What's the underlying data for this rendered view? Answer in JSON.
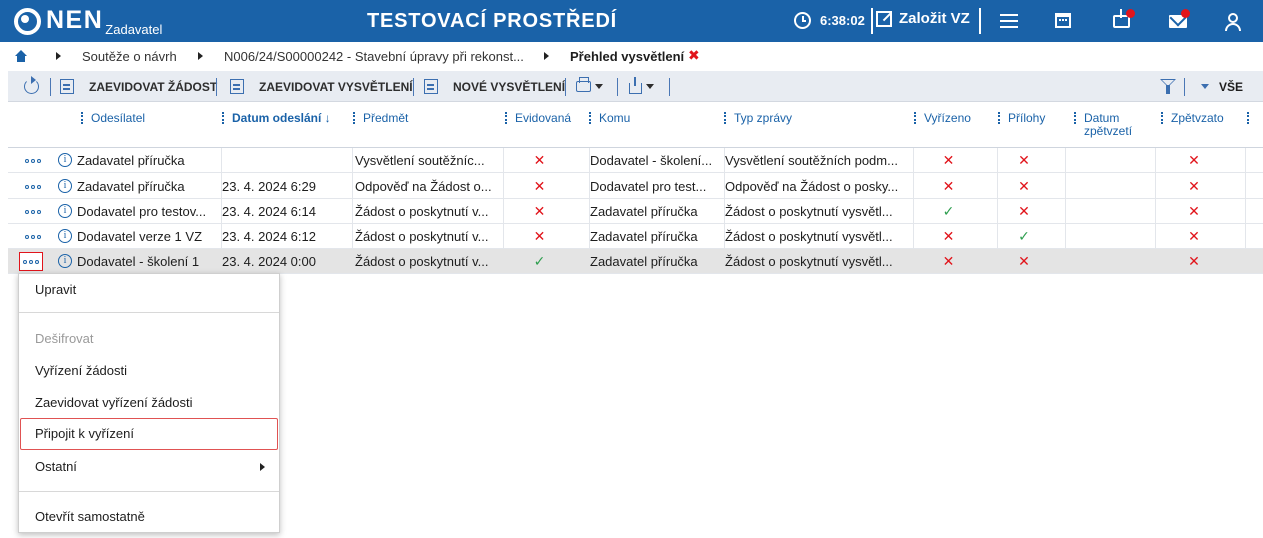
{
  "topbar": {
    "logo_text": "NEN",
    "role": "Zadavatel",
    "environment": "TESTOVACÍ PROSTŘEDÍ",
    "time": "6:38:02",
    "create_label": "Založit VZ"
  },
  "breadcrumb": {
    "items": [
      "Soutěže o návrh",
      "N006/24/S00000242 - Stavební úpravy při rekonst...",
      "Přehled vysvětlení"
    ],
    "close_symbol": "✖"
  },
  "toolbar": {
    "register_request": "ZAEVIDOVAT ŽÁDOST",
    "register_explanation": "ZAEVIDOVAT VYSVĚTLENÍ",
    "new_explanation": "NOVÉ VYSVĚTLENÍ",
    "all_label": "VŠE"
  },
  "table": {
    "columns": [
      "Odesílatel",
      "Datum odeslání ↓",
      "Předmět",
      "Evidovaná",
      "Komu",
      "Typ zprávy",
      "Vyřízeno",
      "Přílohy",
      "Datum zpětvzetí",
      "Zpětvzato"
    ],
    "rows": [
      {
        "sender": "Zadavatel příručka",
        "date": "",
        "subject": "Vysvětlení soutěžníc...",
        "registered": "✕",
        "to": "Dodavatel - školení...",
        "type": "Vysvětlení soutěžních podm...",
        "resolved": "✕",
        "attachments": "✕",
        "withdrawal_date": "",
        "withdrawn": "✕"
      },
      {
        "sender": "Zadavatel příručka",
        "date": "23. 4. 2024 6:29",
        "subject": "Odpověď na Žádost o...",
        "registered": "✕",
        "to": "Dodavatel pro test...",
        "type": "Odpověď na Žádost o posky...",
        "resolved": "✕",
        "attachments": "✕",
        "withdrawal_date": "",
        "withdrawn": "✕"
      },
      {
        "sender": "Dodavatel pro testov...",
        "date": "23. 4. 2024 6:14",
        "subject": "Žádost o poskytnutí v...",
        "registered": "✕",
        "to": "Zadavatel příručka",
        "type": "Žádost o poskytnutí vysvětl...",
        "resolved": "✓",
        "attachments": "✕",
        "withdrawal_date": "",
        "withdrawn": "✕"
      },
      {
        "sender": "Dodavatel verze 1 VZ",
        "date": "23. 4. 2024 6:12",
        "subject": "Žádost o poskytnutí v...",
        "registered": "✕",
        "to": "Zadavatel příručka",
        "type": "Žádost o poskytnutí vysvětl...",
        "resolved": "✕",
        "attachments": "✓",
        "withdrawal_date": "",
        "withdrawn": "✕"
      },
      {
        "sender": "Dodavatel - školení 1",
        "date": "23. 4. 2024 0:00",
        "subject": "Žádost o poskytnutí v...",
        "registered": "✓",
        "to": "Zadavatel příručka",
        "type": "Žádost o poskytnutí vysvětl...",
        "resolved": "✕",
        "attachments": "✕",
        "withdrawal_date": "",
        "withdrawn": "✕"
      }
    ]
  },
  "context_menu": {
    "items": [
      "Upravit",
      "Dešifrovat",
      "Vyřízení žádosti",
      "Zaevidovat vyřízení žádosti",
      "Připojit k vyřízení",
      "Ostatní",
      "Otevřít samostatně"
    ]
  },
  "colors": {
    "brand": "#1a62a8",
    "no_mark": "#e1141b",
    "yes_mark": "#2e9e4f",
    "highlight_border": "#e05252"
  }
}
